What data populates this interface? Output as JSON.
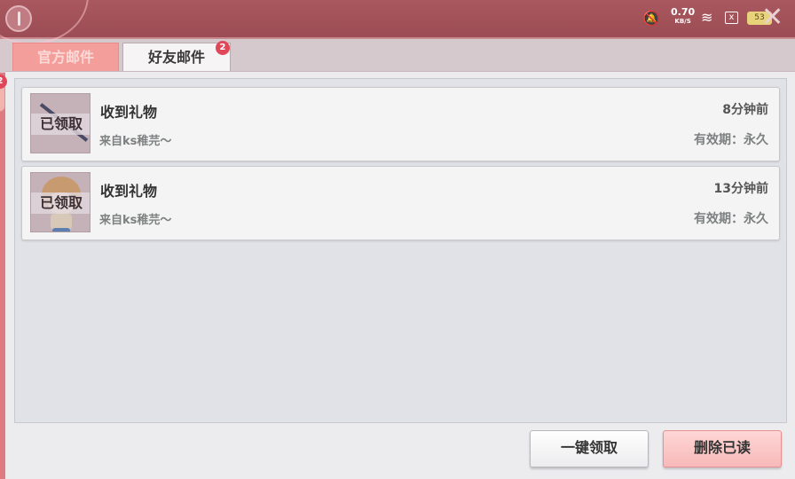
{
  "status_bar": {
    "net_speed": "0.70",
    "net_unit": "KB/S",
    "sim_icon": "x",
    "battery": "53",
    "mute_icon": "bell-off-icon",
    "wifi_icon": "wifi-icon"
  },
  "tabs": [
    {
      "label": "官方邮件",
      "active": false
    },
    {
      "label": "好友邮件",
      "active": true,
      "badge": "2"
    }
  ],
  "side_badge": "2",
  "mails": [
    {
      "title": "收到礼物",
      "from": "来自ks稚芫～",
      "time": "8分钟前",
      "expire": "有效期：永久",
      "claimed_label": "已领取"
    },
    {
      "title": "收到礼物",
      "from": "来自ks稚芫～",
      "time": "13分钟前",
      "expire": "有效期：永久",
      "claimed_label": "已领取"
    }
  ],
  "buttons": {
    "claim_all": "一键领取",
    "delete_read": "删除已读"
  },
  "close_symbol": "✕",
  "colors": {
    "header": "#a9585f",
    "tab_official": "#f49e9c",
    "tab_active": "#f6f4f5",
    "badge": "#e0485a",
    "delete_button": "#f7b9b9"
  }
}
